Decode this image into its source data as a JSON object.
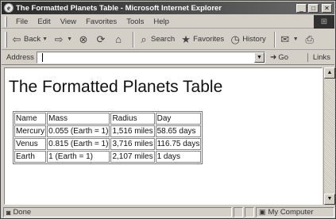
{
  "window": {
    "title": "The Formatted Planets Table - Microsoft Internet Explorer",
    "app_icon": "e-icon"
  },
  "menu": [
    "File",
    "Edit",
    "View",
    "Favorites",
    "Tools",
    "Help"
  ],
  "toolbar": {
    "back_label": "Back",
    "search_label": "Search",
    "favorites_label": "Favorites",
    "history_label": "History"
  },
  "address": {
    "label": "Address",
    "value": "",
    "go_label": "Go",
    "links_label": "Links"
  },
  "page": {
    "heading": "The Formatted Planets Table",
    "table": {
      "headers": [
        "Name",
        "Mass",
        "Radius",
        "Day"
      ],
      "rows": [
        [
          "Mercury",
          "0.055 (Earth = 1)",
          "1,516 miles",
          "58.65 days"
        ],
        [
          "Venus",
          "0.815 (Earth = 1)",
          "3,716 miles",
          "116.75 days"
        ],
        [
          "Earth",
          "1 (Earth = 1)",
          "2,107 miles",
          "1 days"
        ]
      ]
    }
  },
  "status": {
    "text": "Done",
    "zone": "My Computer"
  }
}
